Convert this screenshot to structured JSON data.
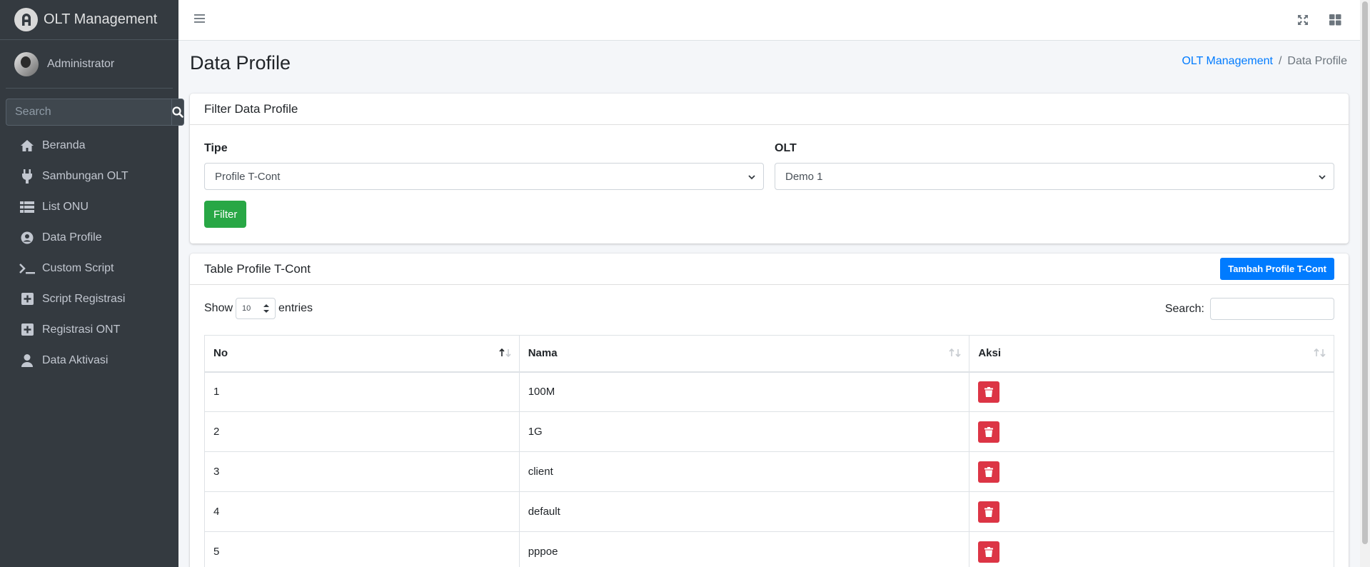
{
  "brand": {
    "title": "OLT Management"
  },
  "user": {
    "name": "Administrator"
  },
  "sidebar_search": {
    "placeholder": "Search"
  },
  "nav": [
    {
      "label": "Beranda",
      "icon": "home-icon"
    },
    {
      "label": "Sambungan OLT",
      "icon": "plug-icon"
    },
    {
      "label": "List ONU",
      "icon": "table-icon"
    },
    {
      "label": "Data Profile",
      "icon": "user-circle-icon"
    },
    {
      "label": "Custom Script",
      "icon": "terminal-icon"
    },
    {
      "label": "Script Registrasi",
      "icon": "plus-square-icon"
    },
    {
      "label": "Registrasi ONT",
      "icon": "plus-square-icon"
    },
    {
      "label": "Data Aktivasi",
      "icon": "user-icon"
    }
  ],
  "page": {
    "title": "Data Profile"
  },
  "breadcrumb": {
    "parent": "OLT Management",
    "separator": "/",
    "current": "Data Profile"
  },
  "filter": {
    "title": "Filter Data Profile",
    "tipe_label": "Tipe",
    "tipe_value": "Profile T-Cont",
    "olt_label": "OLT",
    "olt_value": "Demo 1",
    "button": "Filter"
  },
  "table_card": {
    "title": "Table Profile T-Cont",
    "add_button": "Tambah Profile T-Cont",
    "show_label": "Show",
    "entries_value": "10",
    "entries_label": "entries",
    "search_label": "Search:",
    "columns": [
      "No",
      "Nama",
      "Aksi"
    ],
    "rows": [
      {
        "no": "1",
        "nama": "100M"
      },
      {
        "no": "2",
        "nama": "1G"
      },
      {
        "no": "3",
        "nama": "client"
      },
      {
        "no": "4",
        "nama": "default"
      },
      {
        "no": "5",
        "nama": "pppoe"
      }
    ]
  },
  "colors": {
    "sidebar": "#343a40",
    "primary": "#007bff",
    "success": "#28a745",
    "danger": "#dc3545"
  }
}
